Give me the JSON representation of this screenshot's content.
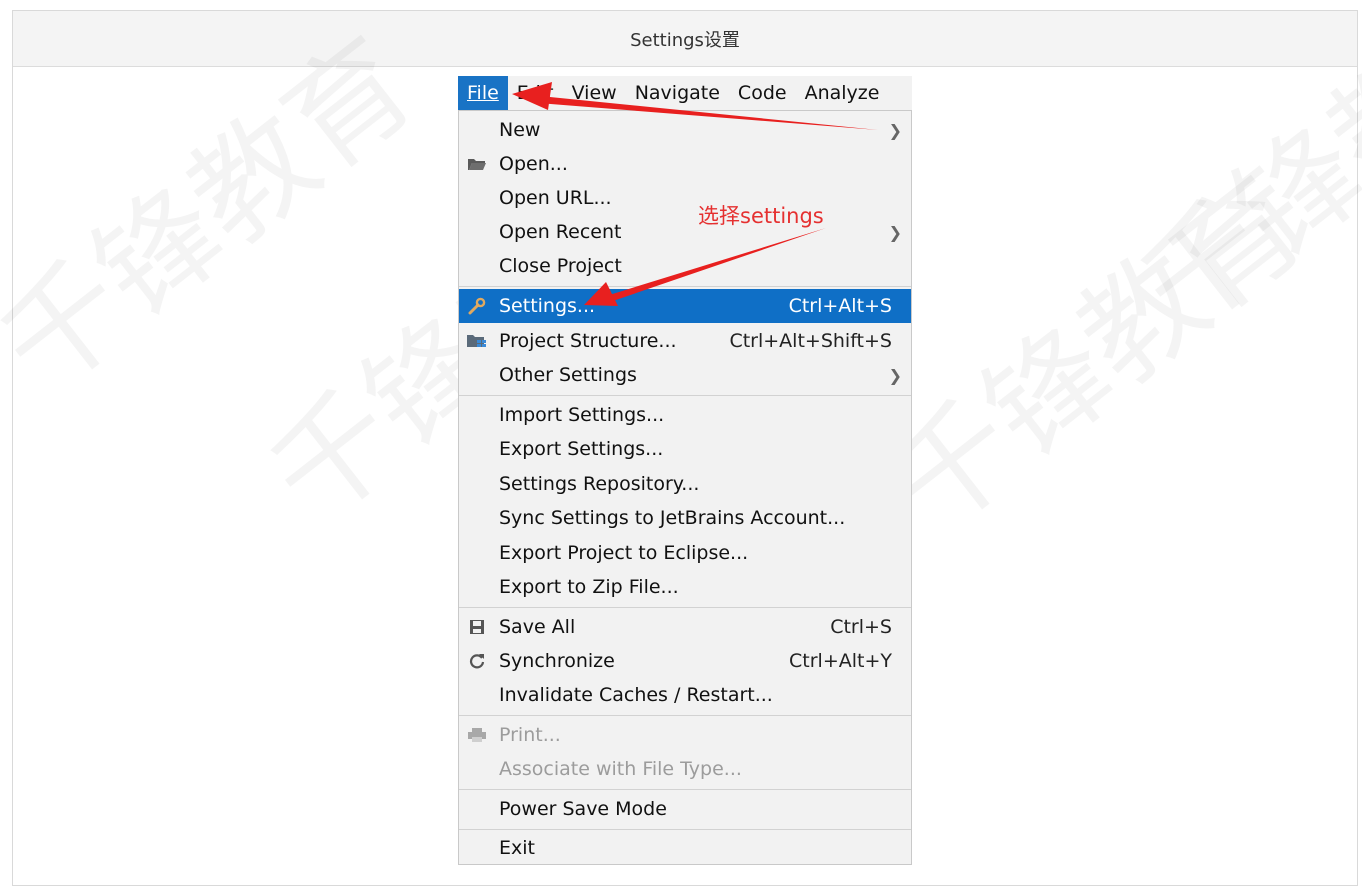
{
  "header": {
    "title": "Settings设置"
  },
  "watermarks": [
    "千锋教育",
    "千锋教育",
    "千锋教育",
    "千锋教育"
  ],
  "menubar": [
    {
      "label": "File",
      "active": true
    },
    {
      "label": "Edit",
      "active": false
    },
    {
      "label": "View",
      "active": false
    },
    {
      "label": "Navigate",
      "active": false
    },
    {
      "label": "Code",
      "active": false
    },
    {
      "label": "Analyze",
      "active": false
    }
  ],
  "items": {
    "new": {
      "label": "New"
    },
    "open": {
      "label": "Open...",
      "icon": "folder-icon"
    },
    "open_url": {
      "label": "Open URL..."
    },
    "open_recent": {
      "label": "Open Recent"
    },
    "close_project": {
      "label": "Close Project"
    },
    "settings": {
      "label": "Settings...",
      "shortcut": "Ctrl+Alt+S",
      "icon": "wrench-icon"
    },
    "project_structure": {
      "label": "Project Structure...",
      "shortcut": "Ctrl+Alt+Shift+S",
      "icon": "project-structure-icon"
    },
    "other_settings": {
      "label": "Other Settings"
    },
    "import_settings": {
      "label": "Import Settings..."
    },
    "export_settings": {
      "label": "Export Settings..."
    },
    "settings_repository": {
      "label": "Settings Repository..."
    },
    "sync_settings": {
      "label": "Sync Settings to JetBrains Account..."
    },
    "export_eclipse": {
      "label": "Export Project to Eclipse..."
    },
    "export_zip": {
      "label": "Export to Zip File..."
    },
    "save_all": {
      "label": "Save All",
      "shortcut": "Ctrl+S",
      "icon": "save-icon"
    },
    "synchronize": {
      "label": "Synchronize",
      "shortcut": "Ctrl+Alt+Y",
      "icon": "sync-icon"
    },
    "invalidate": {
      "label": "Invalidate Caches / Restart..."
    },
    "print": {
      "label": "Print...",
      "icon": "printer-icon"
    },
    "associate": {
      "label": "Associate with File Type..."
    },
    "power_save": {
      "label": "Power Save Mode"
    },
    "exit": {
      "label": "Exit"
    }
  },
  "annotation": {
    "text": "选择settings",
    "color": "#e53030"
  },
  "colors": {
    "selected": "#0f6fc6",
    "menu_bg": "#f2f2f2",
    "arrow": "#e8201f"
  }
}
